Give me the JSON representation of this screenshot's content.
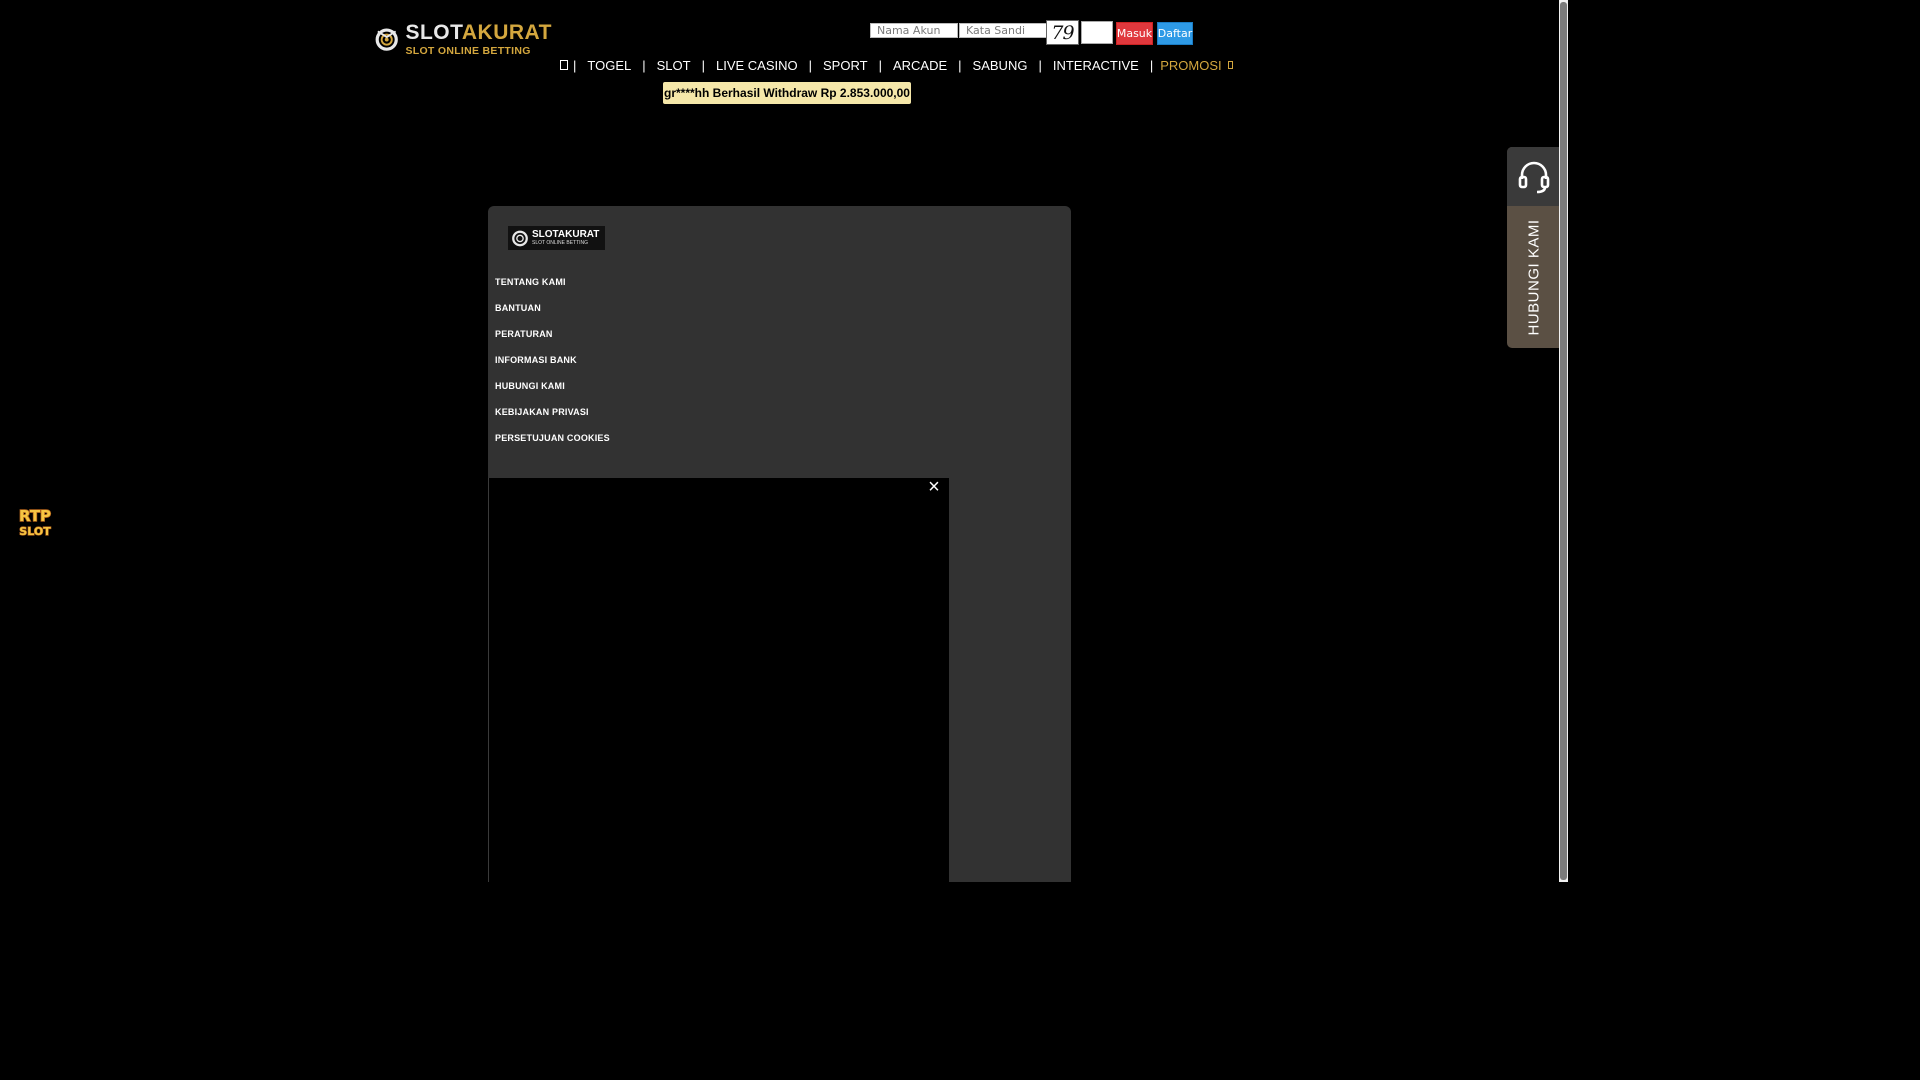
{
  "brand": {
    "name_white": "SLOT",
    "name_gold": "AKURAT",
    "tagline": "SLOT ONLINE BETTING"
  },
  "login": {
    "username_placeholder": "Nama Akun",
    "password_placeholder": "Kata Sandi",
    "captcha": "79",
    "login_label": "Masuk",
    "register_label": "Daftar"
  },
  "nav": {
    "home_icon": "home-icon",
    "items": [
      "TOGEL",
      "SLOT",
      "LIVE CASINO",
      "SPORT",
      "ARCADE",
      "SABUNG",
      "INTERACTIVE"
    ],
    "promo_label": "PROMOSI",
    "separator": "|"
  },
  "notice": {
    "text": "gr****hh Berhasil Withdraw Rp 2.853.000,00"
  },
  "footer_panel": {
    "logo_name": "SLOTAKURAT",
    "logo_tagline": "SLOT ONLINE BETTING",
    "links": [
      "TENTANG KAMI",
      "BANTUAN",
      "PERATURAN",
      "INFORMASI BANK",
      "HUBUNGI KAMI",
      "KEBIJAKAN PRIVASI",
      "PERSETUJUAN COOKIES"
    ]
  },
  "popup": {
    "close_glyph": "×"
  },
  "contact_tab": {
    "label": "HUBUNGI KAMI",
    "icon": "headset-icon"
  },
  "rtp_badge": {
    "line1": "RTP",
    "line2": "SLOT"
  },
  "colors": {
    "background": "#000000",
    "gold": "#d4a73e",
    "panel": "#323232",
    "notice_bg": "#f5e7a9",
    "login_button": "#e0383d",
    "register_button": "#2e9ae6",
    "contact_tab": "#5b5044"
  }
}
